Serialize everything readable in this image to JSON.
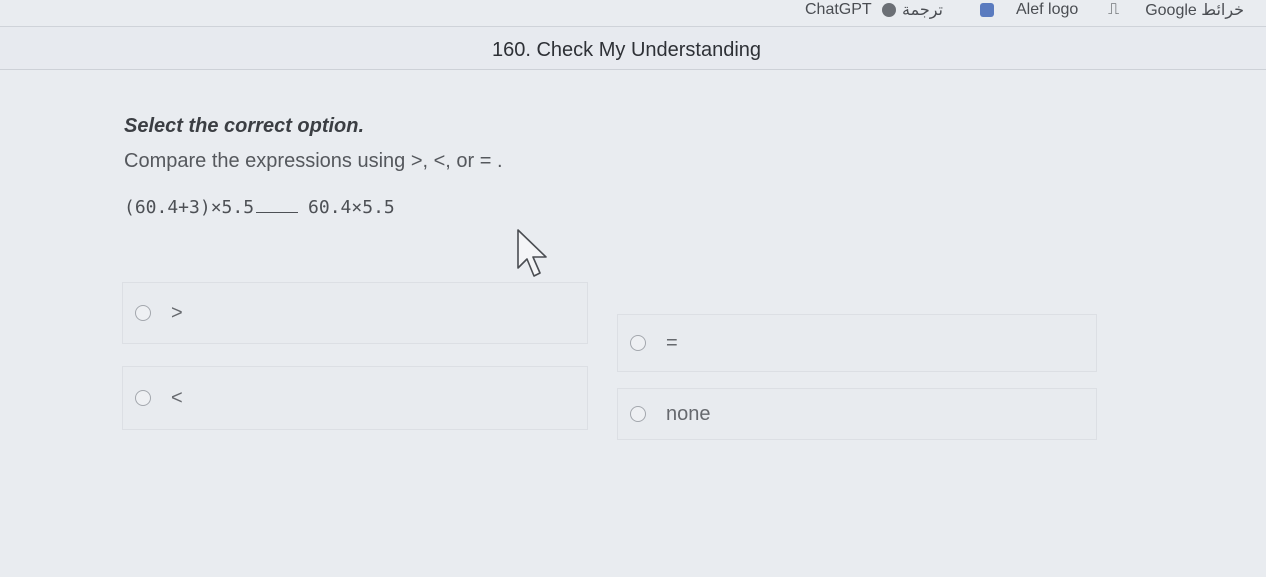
{
  "bookmarks": [
    {
      "label": "ChatGPT",
      "color": "#6b6f75"
    },
    {
      "label": "ترجمة",
      "color": "#5a7bbf"
    },
    {
      "label": "Alef logo",
      "color": "#2f6fb0"
    },
    {
      "label": "Google خرائط",
      "color": "#34a853"
    }
  ],
  "header": {
    "title": "160. Check My Understanding"
  },
  "question": {
    "instruction": "Select the correct option.",
    "prompt": "Compare the expressions using >, <, or = .",
    "left_expression": "(60.4+3)×5.5",
    "right_expression": "60.4×5.5"
  },
  "options": [
    {
      "label": ">"
    },
    {
      "label": "="
    },
    {
      "label": "<"
    },
    {
      "label": "none"
    }
  ]
}
